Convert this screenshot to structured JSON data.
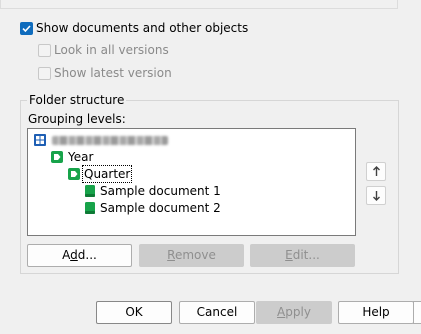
{
  "options": {
    "show_documents": {
      "label": "Show documents and other objects",
      "checked": true
    },
    "look_in_all_versions": {
      "label": "Look in all versions",
      "checked": false,
      "enabled": false
    },
    "show_latest_version": {
      "label": "Show latest version",
      "checked": false,
      "enabled": false
    }
  },
  "folder_structure": {
    "title": "Folder structure",
    "grouping_label": "Grouping levels:",
    "tree": [
      {
        "label": "",
        "icon": "view-grid-icon",
        "depth": 0,
        "redacted": true
      },
      {
        "label": "Year",
        "icon": "tag-icon",
        "depth": 1
      },
      {
        "label": "Quarter",
        "icon": "tag-icon",
        "depth": 2,
        "focused": true
      },
      {
        "label": "Sample document 1",
        "icon": "document-icon",
        "depth": 3
      },
      {
        "label": "Sample document 2",
        "icon": "document-icon",
        "depth": 3
      }
    ],
    "buttons": {
      "add": "Add...",
      "remove": "Remove",
      "edit": "Edit..."
    }
  },
  "dialog_buttons": {
    "ok": "OK",
    "cancel": "Cancel",
    "apply": "Apply",
    "help": "Help"
  },
  "colors": {
    "accent": "#0f6cbd",
    "icon_green": "#17a34a",
    "view_icon_blue": "#1e5fb4",
    "disabled_button": "#cccccc"
  }
}
